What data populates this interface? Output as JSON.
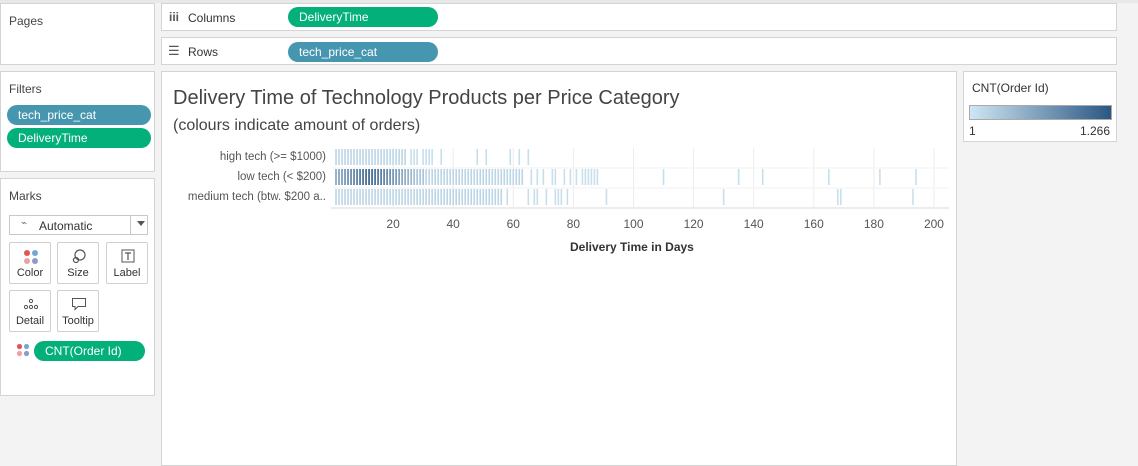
{
  "pages": {
    "title": "Pages"
  },
  "columns": {
    "label": "Columns",
    "pill": "DeliveryTime"
  },
  "rows": {
    "label": "Rows",
    "pill": "tech_price_cat"
  },
  "filters": {
    "title": "Filters",
    "pills": [
      "tech_price_cat",
      "DeliveryTime"
    ]
  },
  "marks": {
    "title": "Marks",
    "type": "Automatic",
    "buttons": [
      {
        "label": "Color",
        "icon": "color-dots-icon"
      },
      {
        "label": "Size",
        "icon": "size-icon"
      },
      {
        "label": "Label",
        "icon": "label-icon"
      },
      {
        "label": "Detail",
        "icon": "detail-icon"
      },
      {
        "label": "Tooltip",
        "icon": "tooltip-icon"
      }
    ],
    "field": "CNT(Order Id)"
  },
  "legend": {
    "title": "CNT(Order Id)",
    "min": "1",
    "max": "1.266",
    "color_low": "#cfe6f3",
    "color_high": "#2a5783"
  },
  "chart": {
    "title": "Delivery Time of Technology Products per Price Category",
    "subtitle": "(colours indicate amount of orders)",
    "xlabel": "Delivery Time in Days"
  },
  "chart_data": {
    "type": "scatter",
    "mark": "tick",
    "categories": [
      "high tech (>= $1000)",
      "low tech (< $200)",
      "medium tech (btw. $200 a.."
    ],
    "xlim": [
      0,
      205
    ],
    "xticks": [
      20,
      40,
      60,
      80,
      100,
      120,
      140,
      160,
      180,
      200
    ],
    "series": [
      {
        "name": "high tech (>= $1000)",
        "dense_range": [
          1,
          24
        ],
        "extra": [
          26,
          27,
          28,
          30,
          31,
          32,
          33,
          36,
          48,
          51,
          59,
          62,
          65
        ]
      },
      {
        "name": "low tech (< $200)",
        "dense_range": [
          1,
          63
        ],
        "extra": [
          66,
          68,
          70,
          73,
          74,
          77,
          79,
          81,
          83,
          84,
          85,
          86,
          87,
          88,
          110,
          135,
          143,
          165,
          182,
          194
        ]
      },
      {
        "name": "medium tech (btw. $200 a..",
        "dense_range": [
          1,
          56
        ],
        "extra": [
          58,
          65,
          67,
          68,
          71,
          74,
          75,
          76,
          78,
          91,
          130,
          168,
          169,
          193
        ]
      }
    ]
  }
}
